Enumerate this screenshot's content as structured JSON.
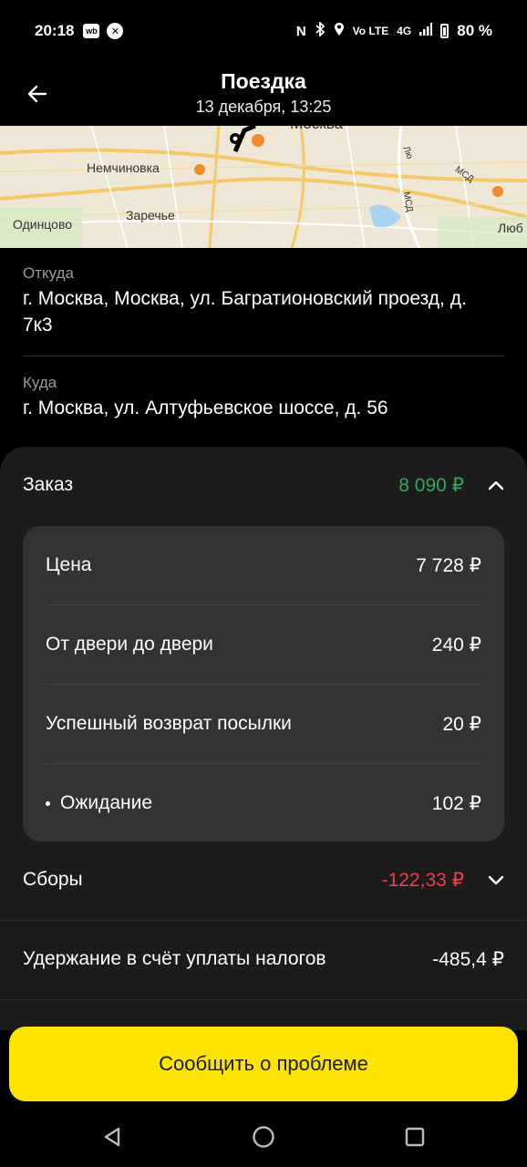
{
  "status_bar": {
    "time": "20:18",
    "app_icon_1": "wb",
    "app_icon_2": "x-circle",
    "network": "4G",
    "lte": "Vo LTE",
    "battery": "80 %"
  },
  "header": {
    "title": "Поездка",
    "subtitle": "13 декабря, 13:25"
  },
  "map": {
    "labels": [
      "Москва",
      "Немчиновка",
      "Одинцово",
      "Заречье",
      "Люб",
      "МСД",
      "МСД",
      "Лю"
    ]
  },
  "route": {
    "from_caption": "Откуда",
    "from_address": "г. Москва, Москва, ул. Багратионовский проезд, д. 7к3",
    "to_caption": "Куда",
    "to_address": "г. Москва, ул. Алтуфьевское шоссе, д. 56"
  },
  "order": {
    "label": "Заказ",
    "total": "8 090 ₽",
    "items": [
      {
        "label": "Цена",
        "value": "7 728 ₽"
      },
      {
        "label": "От двери до двери",
        "value": "240 ₽"
      },
      {
        "label": "Успешный возврат посылки",
        "value": "20 ₽"
      },
      {
        "label": "Ожидание",
        "value": "102 ₽"
      }
    ]
  },
  "fees": {
    "label": "Сборы",
    "value": "-122,33 ₽"
  },
  "tax": {
    "label": "Удержание в счёт уплаты налогов",
    "value": "-485,4 ₽"
  },
  "actions": {
    "report_problem": "Сообщить о проблеме"
  },
  "colors": {
    "accent": "#fde400",
    "positive": "#2fa85a",
    "negative": "#e8434b"
  }
}
